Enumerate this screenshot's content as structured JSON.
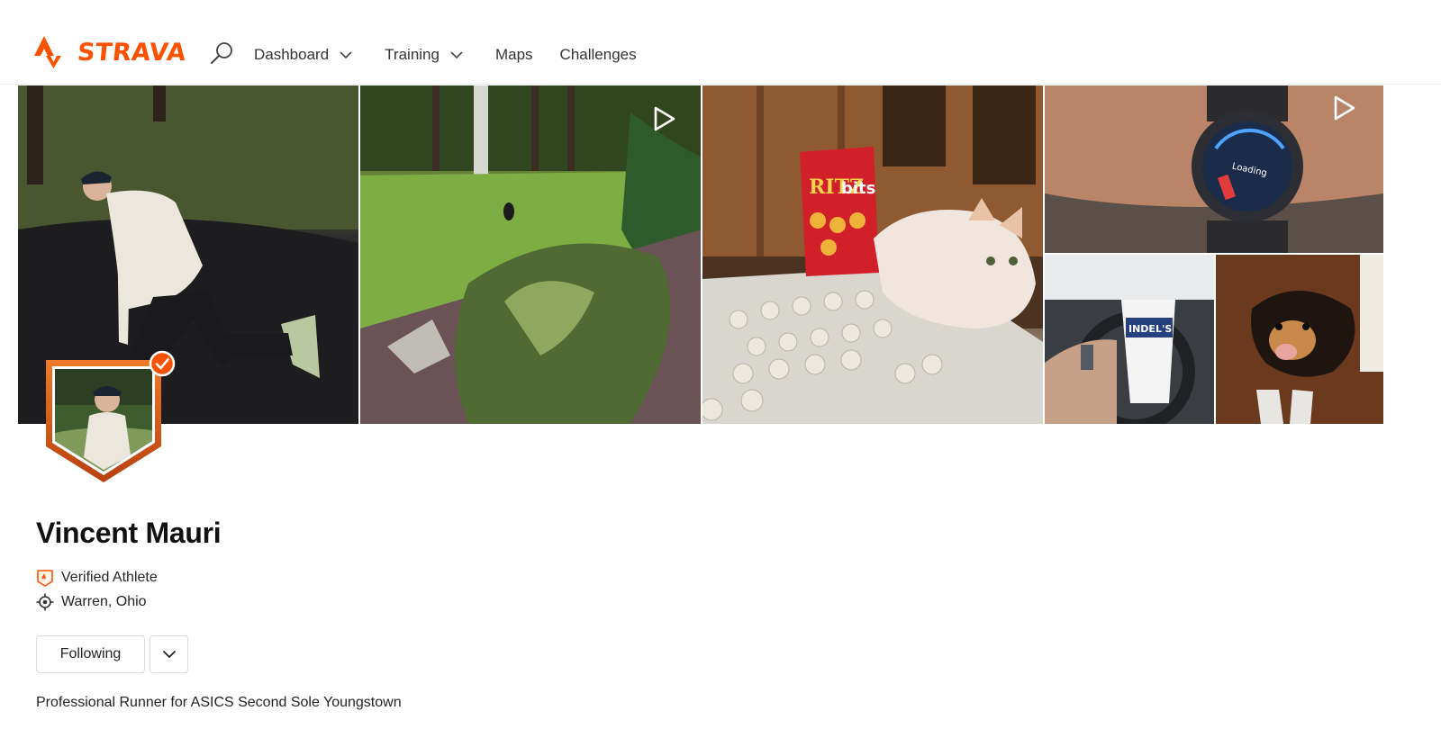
{
  "header": {
    "brand": "STRAVA",
    "logo_icon": "strava-chevron-logo",
    "search_icon": "search-icon",
    "nav": [
      {
        "label": "Dashboard",
        "has_dropdown": true
      },
      {
        "label": "Training",
        "has_dropdown": true
      },
      {
        "label": "Maps",
        "has_dropdown": false
      },
      {
        "label": "Challenges",
        "has_dropdown": false
      }
    ]
  },
  "cover_photos": [
    {
      "id": "photo-1",
      "description_icon": "photo",
      "is_video": false
    },
    {
      "id": "photo-2",
      "description_icon": "photo",
      "is_video": true
    },
    {
      "id": "photo-3",
      "description_icon": "photo",
      "is_video": false
    },
    {
      "id": "photo-4",
      "description_icon": "photo",
      "is_video": true
    },
    {
      "id": "photo-5",
      "description_icon": "photo",
      "is_video": false
    },
    {
      "id": "photo-6",
      "description_icon": "photo",
      "is_video": false
    }
  ],
  "photo_text": {
    "snack_brand": "RITZ",
    "snack_name": "bits",
    "watch_screen": "Loading",
    "cup_text": "INDEL'S"
  },
  "profile": {
    "name": "Vincent Mauri",
    "verified_label": "Verified Athlete",
    "location": "Warren, Ohio",
    "follow_button": "Following",
    "bio": "Professional Runner for ASICS Second Sole Youngstown"
  },
  "colors": {
    "brand": "#fc5200",
    "text": "#242428",
    "border": "#dcdcdc",
    "avatar_frame": "#e8641c"
  }
}
